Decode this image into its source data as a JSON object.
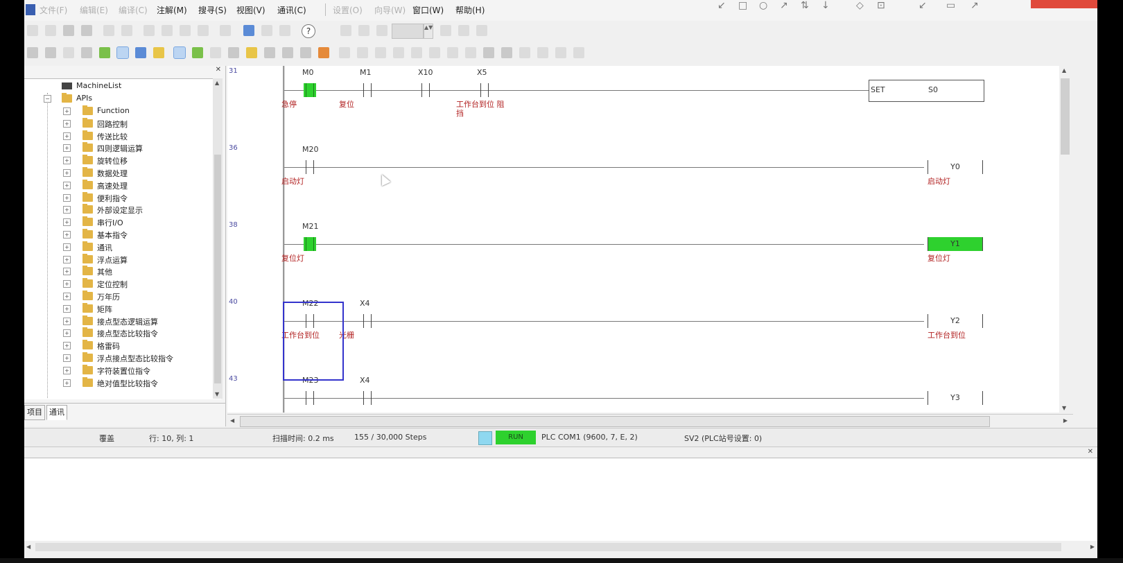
{
  "menu": {
    "items": [
      {
        "label": "文件(F)",
        "disabled": true
      },
      {
        "label": "编辑(E)",
        "disabled": true
      },
      {
        "label": "编译(C)",
        "disabled": true
      },
      {
        "label": "注解(M)",
        "disabled": false
      },
      {
        "label": "搜寻(S)",
        "disabled": false
      },
      {
        "label": "视图(V)",
        "disabled": false
      },
      {
        "label": "通讯(C)",
        "disabled": false
      },
      {
        "label": "设置(O)",
        "disabled": true
      },
      {
        "label": "向导(W)",
        "disabled": true
      },
      {
        "label": "窗口(W)",
        "disabled": false
      },
      {
        "label": "帮助(H)",
        "disabled": false
      }
    ]
  },
  "left_panel": {
    "title": "✕",
    "tree": {
      "root_label": "MachineList",
      "apis_label": "APIs",
      "folders": [
        "Function",
        "回路控制",
        "传送比较",
        "四则逻辑运算",
        "旋转位移",
        "数据处理",
        "高速处理",
        "便利指令",
        "外部设定显示",
        "串行I/O",
        "基本指令",
        "通讯",
        "浮点运算",
        "其他",
        "定位控制",
        "万年历",
        "矩阵",
        "接点型态逻辑运算",
        "接点型态比较指令",
        "格雷码",
        "浮点接点型态比较指令",
        "字符装置位指令",
        "绝对值型比较指令"
      ]
    },
    "tabs": [
      "项目",
      "通讯"
    ]
  },
  "ladder": {
    "rungs": [
      {
        "step": "31",
        "contacts": [
          {
            "device": "M0",
            "comment": "急停",
            "on": true
          },
          {
            "device": "M1",
            "comment": "复位",
            "on": false
          },
          {
            "device": "X10",
            "comment": "",
            "on": false
          },
          {
            "device": "X5",
            "comment": "工作台到位 阻挡",
            "on": false
          }
        ],
        "output": {
          "type": "instruction",
          "op": "SET",
          "operand": "S0",
          "comment": ""
        }
      },
      {
        "step": "36",
        "contacts": [
          {
            "device": "M20",
            "comment": "启动灯",
            "on": false
          }
        ],
        "output": {
          "type": "coil",
          "device": "Y0",
          "comment": "启动灯",
          "on": false
        }
      },
      {
        "step": "38",
        "contacts": [
          {
            "device": "M21",
            "comment": "复位灯",
            "on": true
          }
        ],
        "output": {
          "type": "coil",
          "device": "Y1",
          "comment": "复位灯",
          "on": true
        }
      },
      {
        "step": "40",
        "contacts": [
          {
            "device": "M22",
            "comment": "工作台到位",
            "on": false
          },
          {
            "device": "X4",
            "comment": "光栅",
            "on": false
          }
        ],
        "output": {
          "type": "coil",
          "device": "Y2",
          "comment": "工作台到位",
          "on": false
        }
      },
      {
        "step": "43",
        "contacts": [
          {
            "device": "M23",
            "comment": "",
            "on": false
          },
          {
            "device": "X4",
            "comment": "",
            "on": false
          }
        ],
        "output": {
          "type": "coil",
          "device": "Y3",
          "comment": "",
          "on": false
        }
      }
    ]
  },
  "status": {
    "mode": "覆盖",
    "position": "行: 10, 列: 1",
    "scan_time": "扫描时间: 0.2 ms",
    "steps": "155 / 30,000 Steps",
    "plc_state": "RUN",
    "comm": "PLC COM1 (9600, 7, E, 2)",
    "model": "SV2 (PLC站号设置: 0)"
  },
  "output_panel": {
    "title": "✕"
  },
  "colors": {
    "on_green": "#2ed12e",
    "comment_red": "#b22222",
    "cursor_blue": "#3333cc"
  }
}
